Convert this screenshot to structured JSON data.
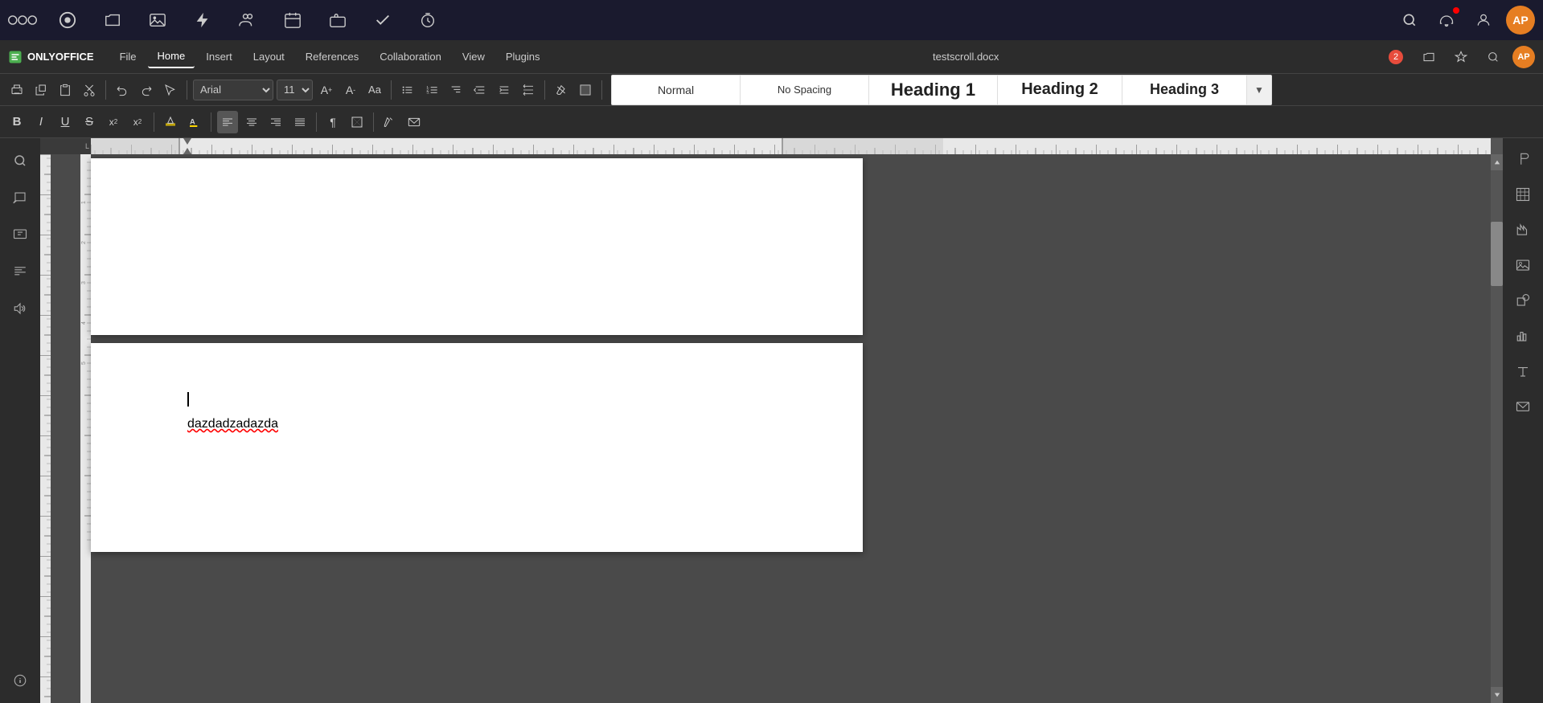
{
  "app": {
    "logo_text": "OOO",
    "title": "testscroll.docx"
  },
  "topnav": {
    "icons": [
      "files",
      "folder",
      "image",
      "lightning",
      "people",
      "calendar",
      "briefcase",
      "check",
      "timer"
    ],
    "search_label": "search",
    "notifications_label": "notifications",
    "contacts_label": "contacts",
    "avatar_label": "AP",
    "notification_count": "2"
  },
  "menubar": {
    "brand": "ONLYOFFICE",
    "items": [
      "File",
      "Home",
      "Insert",
      "Layout",
      "References",
      "Collaboration",
      "View",
      "Plugins"
    ],
    "active_item": "Home",
    "file_title": "testscroll.docx",
    "collab_count": "2"
  },
  "toolbar1": {
    "buttons": [
      "print",
      "copy-style",
      "paste",
      "cut",
      "undo",
      "redo",
      "select-all"
    ],
    "font_name": "Arial",
    "font_size": "11",
    "font_size_up": "A+",
    "font_size_down": "A-",
    "change_case": "Aa"
  },
  "toolbar2": {
    "bold": "B",
    "italic": "I",
    "underline": "U",
    "strikethrough": "S",
    "superscript": "x²",
    "subscript": "x₂",
    "highlight": "highlight",
    "font_color": "A",
    "align_left": "align-left",
    "align_center": "align-center",
    "align_right": "align-right",
    "justify": "justify",
    "paragraph": "¶",
    "shading": "shading",
    "copy_formatting": "copy-fmt",
    "mail_merge": "mail"
  },
  "styles": {
    "normal_label": "Normal",
    "no_spacing_label": "No Spacing",
    "heading1_label": "Heading 1",
    "heading2_label": "Heading 2",
    "heading3_label": "Heading 3",
    "expand_label": "▼"
  },
  "document": {
    "page2": {
      "cursor_visible": true,
      "text_content": "dazdadzadazda",
      "has_spell_error": true
    }
  },
  "right_panel": {
    "icons": [
      "pilcrow",
      "table",
      "chart-column",
      "image",
      "shape",
      "chart",
      "text",
      "mail"
    ]
  }
}
